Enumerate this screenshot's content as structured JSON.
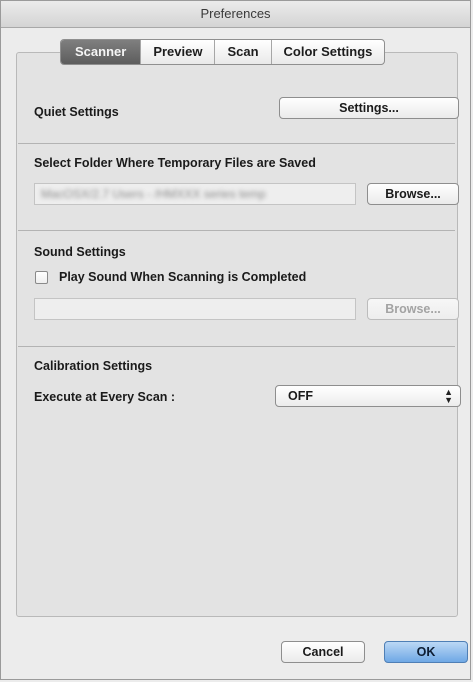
{
  "window": {
    "title": "Preferences"
  },
  "tabs": [
    {
      "label": "Scanner",
      "active": true
    },
    {
      "label": "Preview",
      "active": false
    },
    {
      "label": "Scan",
      "active": false
    },
    {
      "label": "Color Settings",
      "active": false
    }
  ],
  "quiet_settings": {
    "label": "Quiet Settings",
    "button": "Settings..."
  },
  "temp_folder": {
    "label": "Select Folder Where Temporary Files are Saved",
    "path": "MacOSX/2.7 Users - /HMXXX series temp",
    "browse": "Browse..."
  },
  "sound_settings": {
    "label": "Sound Settings",
    "checkbox_label": "Play Sound When Scanning is Completed",
    "checked": false,
    "path": "",
    "browse": "Browse..."
  },
  "calibration": {
    "label": "Calibration Settings",
    "execute_label": "Execute at Every Scan :",
    "selected": "OFF"
  },
  "footer": {
    "cancel": "Cancel",
    "ok": "OK"
  }
}
